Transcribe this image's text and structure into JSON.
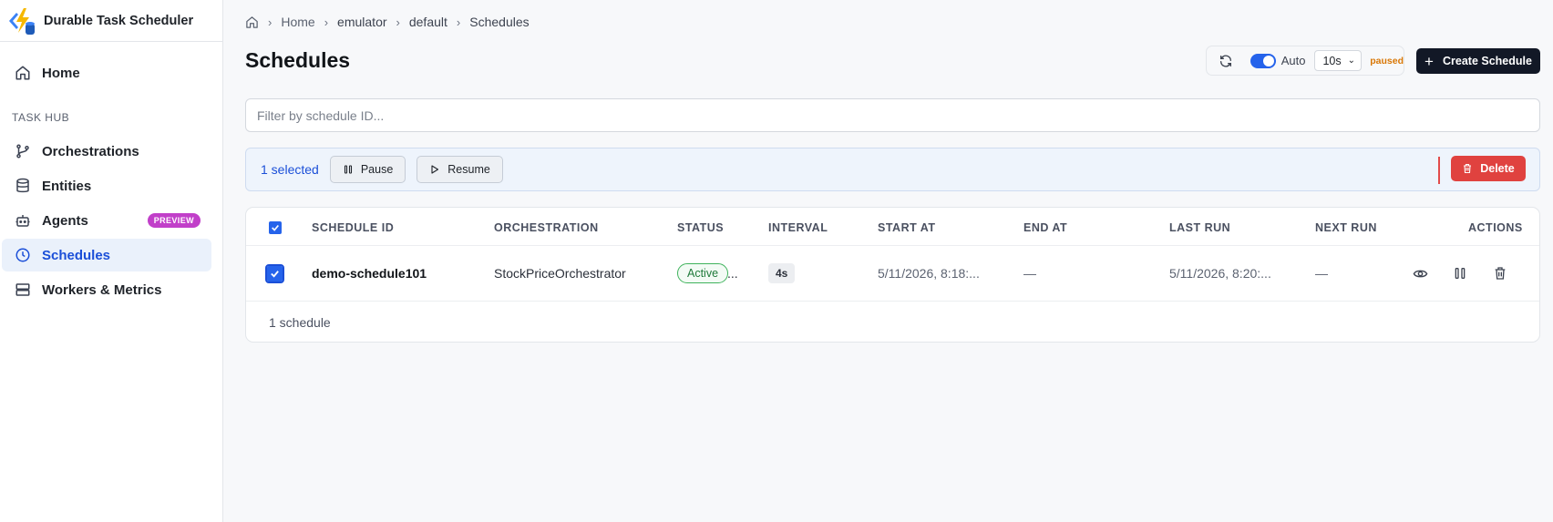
{
  "app": {
    "title": "Durable Task Scheduler"
  },
  "sidebar": {
    "home": "Home",
    "section_label": "TASK HUB",
    "items": [
      {
        "label": "Orchestrations",
        "icon": "branch-icon"
      },
      {
        "label": "Entities",
        "icon": "database-icon"
      },
      {
        "label": "Agents",
        "icon": "bot-icon",
        "badge": "PREVIEW"
      },
      {
        "label": "Schedules",
        "icon": "clock-icon",
        "active": true
      },
      {
        "label": "Workers & Metrics",
        "icon": "server-icon"
      }
    ]
  },
  "breadcrumb": [
    "Home",
    "emulator",
    "default",
    "Schedules"
  ],
  "page": {
    "title": "Schedules"
  },
  "refresh": {
    "auto_label": "Auto",
    "auto_enabled": true,
    "interval": "10s",
    "state": "paused"
  },
  "create_button": "Create Schedule",
  "filter": {
    "placeholder": "Filter by schedule ID...",
    "value": ""
  },
  "selection": {
    "count_text": "1 selected",
    "pause": "Pause",
    "resume": "Resume",
    "delete": "Delete"
  },
  "table": {
    "columns": [
      "SCHEDULE ID",
      "ORCHESTRATION",
      "STATUS",
      "INTERVAL",
      "START AT",
      "END AT",
      "LAST RUN",
      "NEXT RUN",
      "ACTIONS"
    ],
    "rows": [
      {
        "selected": true,
        "schedule_id": "demo-schedule101",
        "orchestration": "StockPriceOrchestrator",
        "status": "Active",
        "status_overflow": "...",
        "interval": "4s",
        "start_at": "5/11/2026, 8:18:...",
        "end_at": "—",
        "last_run": "5/11/2026, 8:20:...",
        "next_run": "—"
      }
    ],
    "footer": "1 schedule"
  },
  "colors": {
    "accent": "#2563eb",
    "active_bg": "#eaf1fb",
    "danger": "#e0423f",
    "status_active": "#3fb35c",
    "paused": "#d97706",
    "preview_badge": "#c13fc9"
  }
}
